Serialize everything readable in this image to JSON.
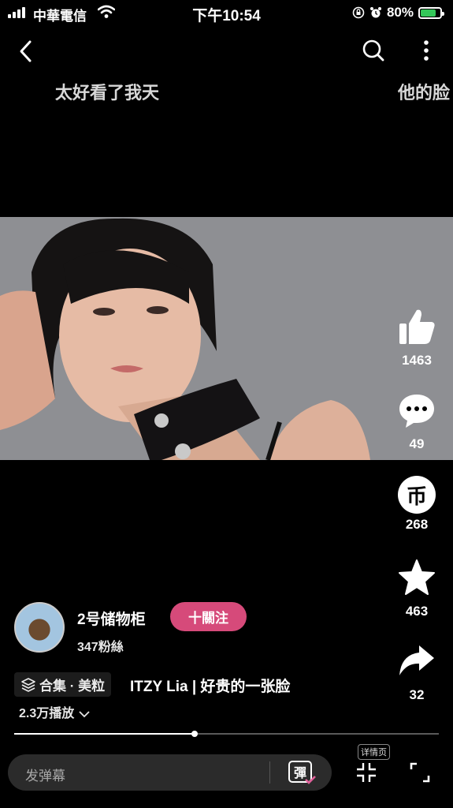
{
  "status_bar": {
    "carrier": "中華電信",
    "time": "下午10:54",
    "battery": "80%",
    "battery_level": 0.8
  },
  "top_bar": {
    "back_icon": "chevron-left-icon",
    "search_icon": "search-icon",
    "more_icon": "more-vertical-icon"
  },
  "danmaku": [
    "太好看了我天",
    "他的脸"
  ],
  "actions": {
    "like": "1463",
    "comment": "49",
    "coin": "268",
    "coin_glyph": "币",
    "favorite": "463",
    "share": "32"
  },
  "uploader": {
    "name": "2号储物柜",
    "fans": "347粉絲",
    "follow_label": "十關注"
  },
  "video": {
    "collection": "合集 · 美粒",
    "title": "ITZY Lia | 好贵的一张脸",
    "plays": "2.3万播放",
    "progress": 0.425
  },
  "bottom": {
    "comment_placeholder": "发弹幕",
    "danmaku_glyph": "彈",
    "detail_label": "详情页"
  },
  "colors": {
    "accent": "#d64a7a",
    "battery_fill": "#34c759"
  }
}
